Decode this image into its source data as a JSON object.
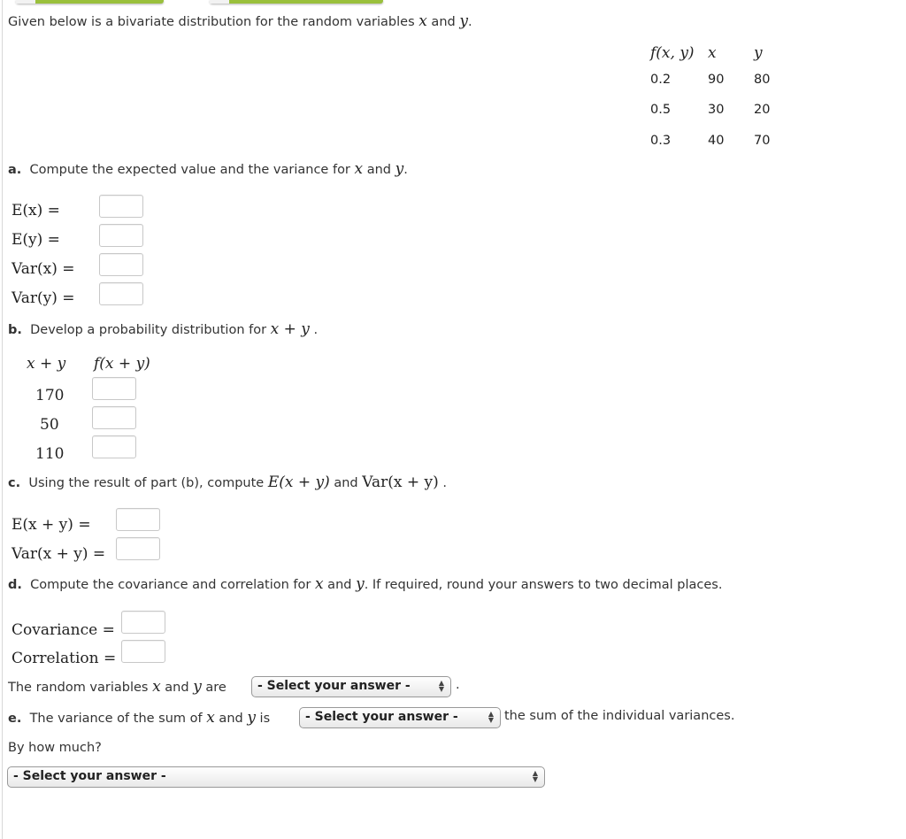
{
  "intro": {
    "prefix": "Given below is a bivariate distribution for the random variables ",
    "var_x": "x",
    "mid": " and ",
    "var_y": "y",
    "suffix": "."
  },
  "dist_table": {
    "headers": [
      "f(x, y)",
      "x",
      "y"
    ],
    "rows": [
      [
        "0.2",
        "90",
        "80"
      ],
      [
        "0.5",
        "30",
        "20"
      ],
      [
        "0.3",
        "40",
        "70"
      ]
    ]
  },
  "part_a": {
    "label": "a.",
    "text_prefix": "Compute the expected value and the variance for ",
    "var_x": "x",
    "mid": " and ",
    "var_y": "y",
    "suffix": ".",
    "fields": [
      {
        "label": "E(x) =",
        "value": ""
      },
      {
        "label": "E(y) =",
        "value": ""
      },
      {
        "label": "Var(x) =",
        "value": ""
      },
      {
        "label": "Var(y) =",
        "value": ""
      }
    ]
  },
  "part_b": {
    "label": "b.",
    "text_prefix": "Develop a probability distribution for ",
    "expr": "x + y",
    "suffix": " .",
    "col_headers": [
      "x + y",
      "f(x + y)"
    ],
    "rows": [
      {
        "sum": "170",
        "value": ""
      },
      {
        "sum": "50",
        "value": ""
      },
      {
        "sum": "110",
        "value": ""
      }
    ]
  },
  "part_c": {
    "label": "c.",
    "text_prefix": "Using the result of part (b), compute ",
    "expr1": "E(x + y)",
    "mid": " and ",
    "expr2": "Var(x + y)",
    "suffix": " .",
    "fields": [
      {
        "label": "E(x + y) =",
        "value": ""
      },
      {
        "label": "Var(x + y) =",
        "value": ""
      }
    ]
  },
  "part_d": {
    "label": "d.",
    "text_prefix": "Compute the covariance and correlation for ",
    "var_x": "x",
    "mid": " and ",
    "var_y": "y",
    "text_suffix": ". If required, round your answers to two decimal places.",
    "fields": [
      {
        "label": "Covariance =",
        "value": ""
      },
      {
        "label": "Correlation =",
        "value": ""
      }
    ],
    "rv_prefix": "The random variables ",
    "rv_x": "x",
    "rv_mid": " and ",
    "rv_y": "y",
    "rv_are": " are",
    "rv_select": "- Select your answer -",
    "rv_suffix": "."
  },
  "part_e": {
    "label": "e.",
    "text_prefix": "The variance of the sum of ",
    "var_x": "x",
    "mid": " and ",
    "var_y": "y",
    "is": " is",
    "select": "- Select your answer -",
    "text_suffix": "the sum of the individual variances.",
    "how_much": "By how much?",
    "how_much_select": "- Select your answer -"
  },
  "colors": {
    "accent_green": "#9ac03c"
  }
}
